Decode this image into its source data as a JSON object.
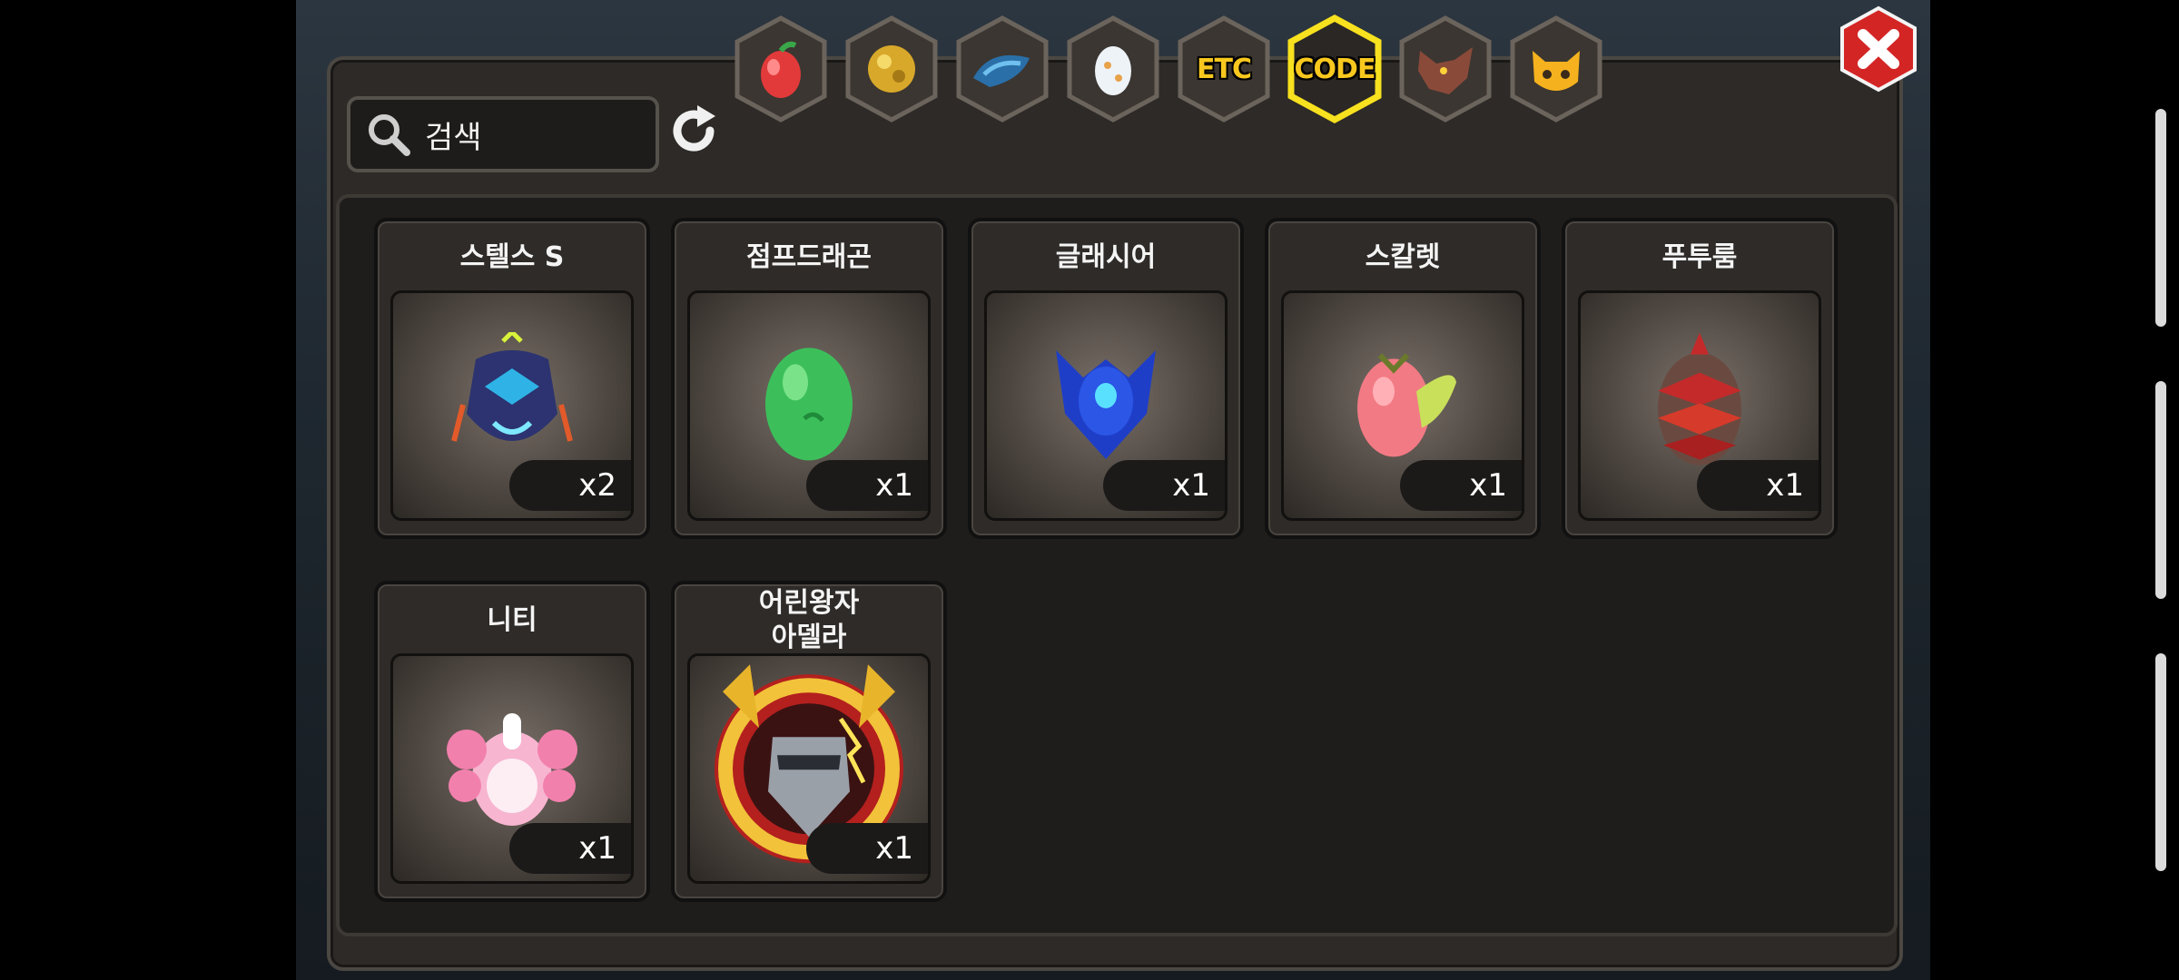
{
  "search": {
    "placeholder": "검색",
    "value": "검색"
  },
  "tabs": [
    {
      "icon": "fruit-icon",
      "label": ""
    },
    {
      "icon": "gold-nugget-icon",
      "label": ""
    },
    {
      "icon": "dragon-scale-icon",
      "label": ""
    },
    {
      "icon": "egg-icon",
      "label": ""
    },
    {
      "icon": "etc-icon",
      "label": "ETC"
    },
    {
      "icon": "code-icon",
      "label": "CODE",
      "selected": true
    },
    {
      "icon": "beast-icon",
      "label": ""
    },
    {
      "icon": "cat-mask-icon",
      "label": ""
    }
  ],
  "colors": {
    "accent": "#f8d21e",
    "close": "#e02a2a",
    "panel": "#2d2a27"
  },
  "items": [
    {
      "name": "스텔스 S",
      "qty": "x2",
      "icon": "stealth-dragon-egg-icon"
    },
    {
      "name": "점프드래곤",
      "qty": "x1",
      "icon": "green-egg-icon"
    },
    {
      "name": "글래시어",
      "qty": "x1",
      "icon": "blue-armored-egg-icon"
    },
    {
      "name": "스칼렛",
      "qty": "x1",
      "icon": "pink-winged-egg-icon"
    },
    {
      "name": "푸투룸",
      "qty": "x1",
      "icon": "red-spiked-egg-icon"
    },
    {
      "name": "니티",
      "qty": "x1",
      "icon": "pink-ribbon-egg-icon"
    },
    {
      "name": "어린왕자\n아델라",
      "qty": "x1",
      "icon": "golden-knight-emblem-icon"
    }
  ]
}
